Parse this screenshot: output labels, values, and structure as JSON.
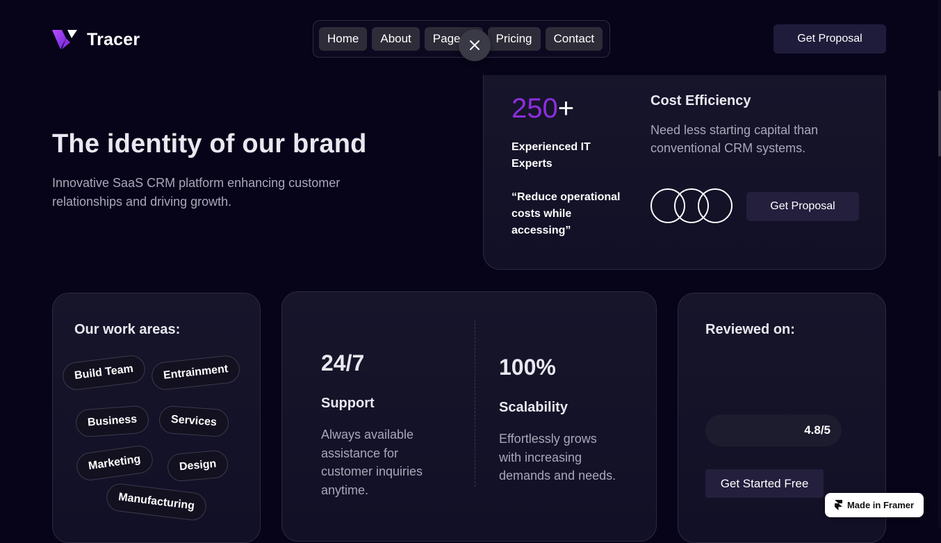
{
  "brand": {
    "name": "Tracer"
  },
  "nav": {
    "items": [
      {
        "label": "Home"
      },
      {
        "label": "About"
      },
      {
        "label": "Pages"
      },
      {
        "label": "Pricing"
      },
      {
        "label": "Contact"
      }
    ],
    "cta_label": "Get Proposal"
  },
  "hero": {
    "title": "The identity of our brand",
    "subtitle": "Innovative SaaS CRM platform enhancing customer relationships and driving growth."
  },
  "experts_card": {
    "number": "250",
    "suffix": "+",
    "label": "Experienced IT Experts",
    "quote": "“Reduce operational costs while accessing”",
    "cost_title": "Cost Efficiency",
    "cost_desc": "Need less starting capital than conventional CRM systems.",
    "cta_label": "Get Proposal"
  },
  "work_areas": {
    "title": "Our work areas:",
    "tags": [
      "Build Team",
      "Entrainment",
      "Business",
      "Services",
      "Marketing",
      "Design",
      "Manufacturing"
    ]
  },
  "stats": [
    {
      "value": "24/7",
      "label": "Support",
      "desc": "Always available assistance for customer inquiries anytime."
    },
    {
      "value": "100%",
      "label": "Scalability",
      "desc": "Effortlessly grows with increasing demands and needs."
    }
  ],
  "review": {
    "title": "Reviewed on:",
    "rating": "4.8/5",
    "cta_label": "Get Started Free"
  },
  "badge": {
    "label": "Made in Framer"
  },
  "colors": {
    "background": "#07041a",
    "accent_purple": "#8e2ee0",
    "button_bg": "#231f3d"
  }
}
